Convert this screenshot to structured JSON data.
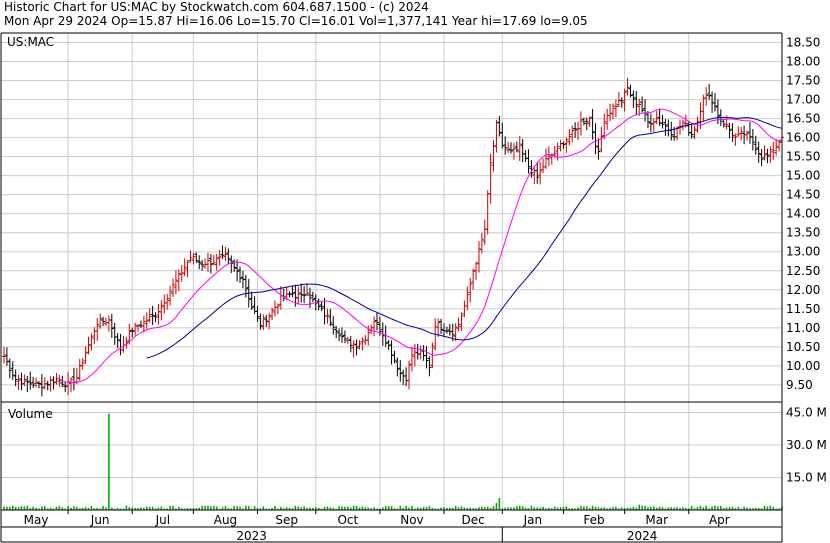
{
  "header": {
    "line1": "Historic Chart for US:MAC by Stockwatch.com 604.687.1500 - (c) 2024",
    "line2": "Mon Apr 29 2024  Op=15.87  Hi=16.06  Lo=15.70  Cl=16.01  Vol=1,377,141  Year hi=17.69  lo=9.05"
  },
  "chart_data": {
    "type": "ohlc",
    "symbol_label": "US:MAC",
    "volume_label": "Volume",
    "price_ticks": [
      "18.50",
      "18.00",
      "17.50",
      "17.00",
      "16.50",
      "16.00",
      "15.50",
      "15.00",
      "14.50",
      "14.00",
      "13.50",
      "13.00",
      "12.50",
      "12.00",
      "11.50",
      "11.00",
      "10.50",
      "10.00",
      "9.50"
    ],
    "price_ylim": [
      9.05,
      18.75
    ],
    "volume_ticks": [
      "45.0 M",
      "30.0 M",
      "15.0 M"
    ],
    "volume_ylim": [
      0,
      48
    ],
    "months": [
      "May",
      "Jun",
      "Jul",
      "Aug",
      "Sep",
      "Oct",
      "Nov",
      "Dec",
      "Jan",
      "Feb",
      "Mar",
      "Apr"
    ],
    "years": [
      "2023",
      "2024"
    ],
    "grid": true,
    "colors": {
      "up": "#cc0000",
      "down": "#000000",
      "ma_short": "#ff00ff",
      "ma_long": "#000099",
      "volume": "#00aa00",
      "grid": "#cccccc"
    },
    "close_anchors": [
      [
        0,
        10.25
      ],
      [
        4,
        9.65
      ],
      [
        8,
        9.55
      ],
      [
        13,
        9.5
      ],
      [
        18,
        9.65
      ],
      [
        22,
        9.5
      ],
      [
        25,
        9.7
      ],
      [
        28,
        10.35
      ],
      [
        32,
        11.15
      ],
      [
        36,
        11.2
      ],
      [
        40,
        10.45
      ],
      [
        44,
        10.95
      ],
      [
        48,
        11.15
      ],
      [
        52,
        11.35
      ],
      [
        56,
        11.85
      ],
      [
        60,
        12.35
      ],
      [
        64,
        12.85
      ],
      [
        68,
        12.7
      ],
      [
        72,
        12.75
      ],
      [
        76,
        12.85
      ],
      [
        78,
        12.65
      ],
      [
        82,
        12.3
      ],
      [
        85,
        11.55
      ],
      [
        88,
        11.1
      ],
      [
        91,
        11.35
      ],
      [
        95,
        11.75
      ],
      [
        99,
        11.9
      ],
      [
        102,
        11.8
      ],
      [
        104,
        12.0
      ],
      [
        106,
        11.7
      ],
      [
        109,
        11.45
      ],
      [
        113,
        11.1
      ],
      [
        117,
        10.65
      ],
      [
        121,
        10.55
      ],
      [
        124,
        10.75
      ],
      [
        127,
        11.2
      ],
      [
        130,
        10.85
      ],
      [
        133,
        10.35
      ],
      [
        136,
        9.8
      ],
      [
        138,
        9.7
      ],
      [
        140,
        10.3
      ],
      [
        143,
        10.35
      ],
      [
        146,
        10.0
      ],
      [
        148,
        11.1
      ],
      [
        151,
        11.0
      ],
      [
        154,
        10.9
      ],
      [
        156,
        11.1
      ],
      [
        159,
        11.8
      ],
      [
        161,
        12.5
      ],
      [
        163,
        13.0
      ],
      [
        165,
        13.6
      ],
      [
        167,
        15.3
      ],
      [
        169,
        16.3
      ],
      [
        171,
        15.8
      ],
      [
        174,
        15.6
      ],
      [
        177,
        15.7
      ],
      [
        180,
        15.25
      ],
      [
        183,
        14.95
      ],
      [
        186,
        15.4
      ],
      [
        189,
        15.6
      ],
      [
        192,
        15.9
      ],
      [
        195,
        16.1
      ],
      [
        198,
        16.4
      ],
      [
        201,
        16.5
      ],
      [
        204,
        15.55
      ],
      [
        206,
        16.5
      ],
      [
        209,
        16.8
      ],
      [
        212,
        17.0
      ],
      [
        214,
        17.3
      ],
      [
        216,
        16.95
      ],
      [
        218,
        16.9
      ],
      [
        221,
        16.4
      ],
      [
        224,
        16.5
      ],
      [
        227,
        16.3
      ],
      [
        230,
        16.1
      ],
      [
        233,
        16.4
      ],
      [
        236,
        16.1
      ],
      [
        238,
        16.45
      ],
      [
        240,
        17.1
      ],
      [
        243,
        17.0
      ],
      [
        245,
        16.6
      ],
      [
        248,
        16.3
      ],
      [
        251,
        16.0
      ],
      [
        254,
        16.1
      ],
      [
        257,
        15.9
      ],
      [
        260,
        15.5
      ],
      [
        262,
        15.5
      ],
      [
        265,
        15.8
      ],
      [
        267,
        16.01
      ]
    ],
    "volume_spikes": [
      [
        36,
        44.5
      ],
      [
        170,
        5.5
      ],
      [
        169,
        3.2
      ],
      [
        218,
        2.4
      ],
      [
        244,
        2.0
      ],
      [
        79,
        1.8
      ],
      [
        120,
        2.0
      ]
    ],
    "ma_short_period": 20,
    "ma_long_period": 50
  }
}
